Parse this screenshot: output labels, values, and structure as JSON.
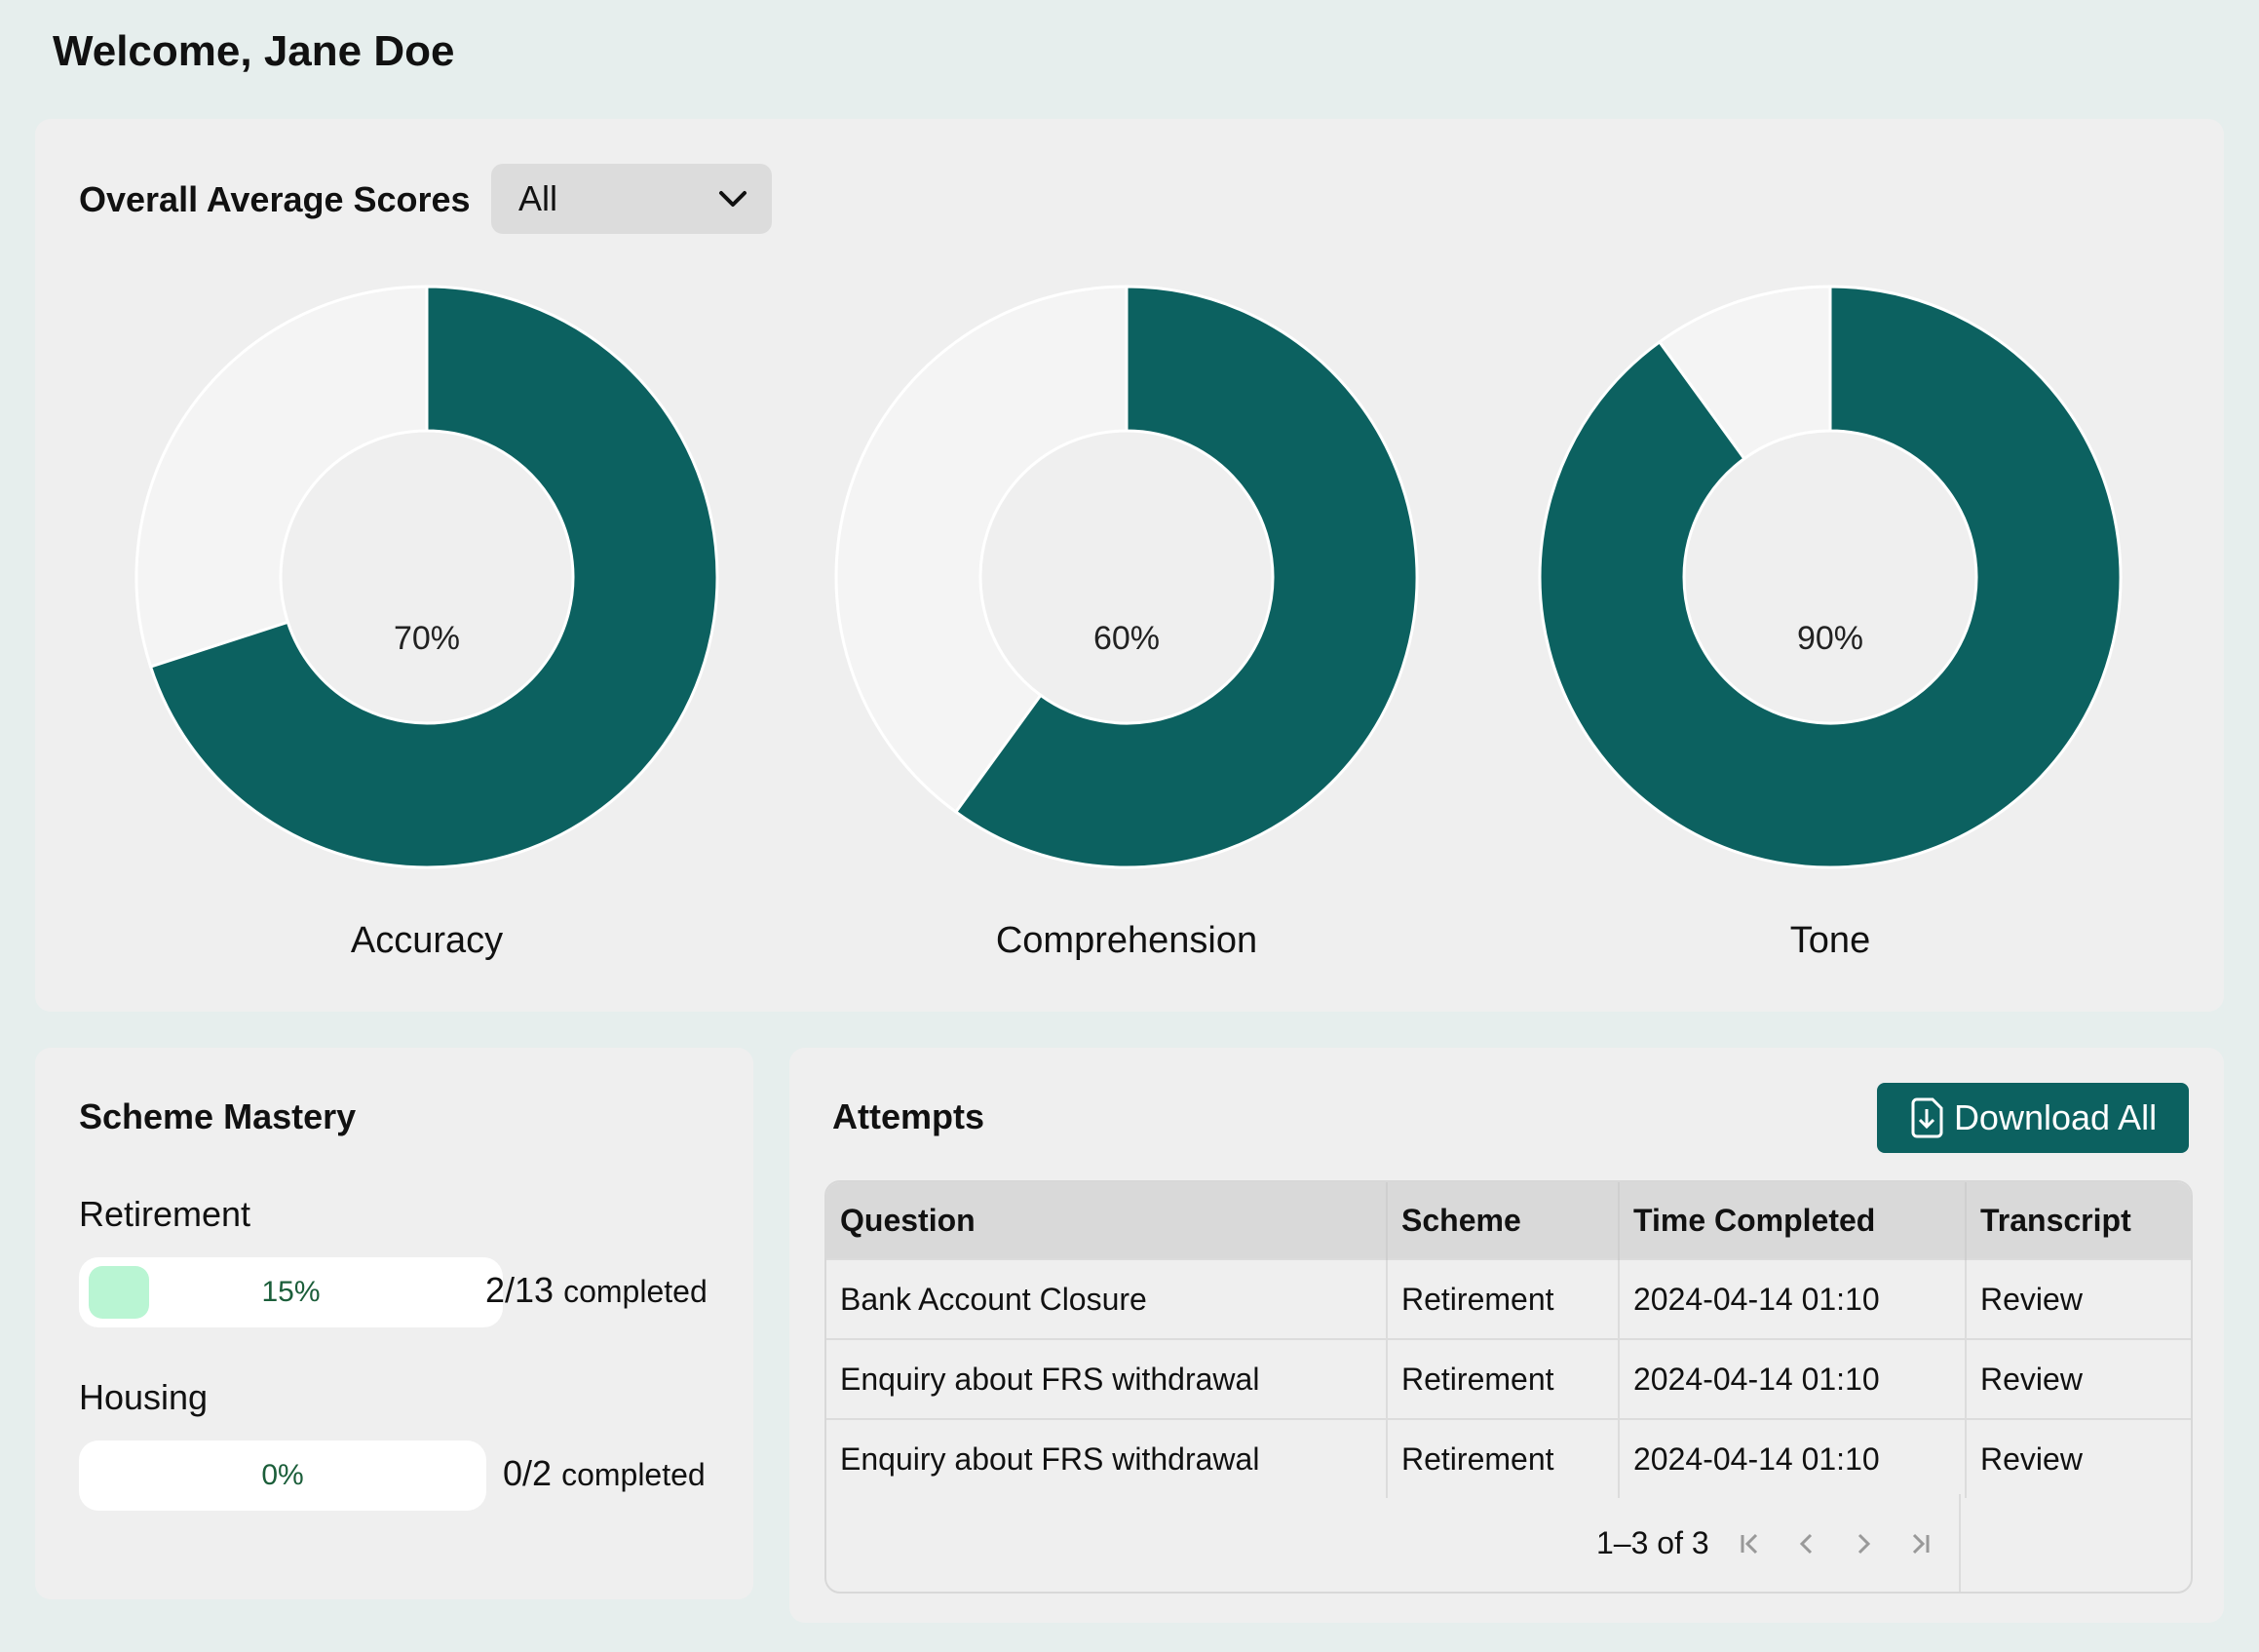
{
  "header": {
    "welcome": "Welcome, Jane Doe"
  },
  "scores": {
    "title": "Overall Average Scores",
    "filter": {
      "selected": "All",
      "icon": "chevron-down-icon"
    },
    "accent_color": "#0c6160",
    "track_color": "#f4f4f4"
  },
  "chart_data": [
    {
      "type": "pie",
      "label": "Accuracy",
      "value": 70,
      "value_label": "70%"
    },
    {
      "type": "pie",
      "label": "Comprehension",
      "value": 60,
      "value_label": "60%"
    },
    {
      "type": "pie",
      "label": "Tone",
      "value": 90,
      "value_label": "90%"
    }
  ],
  "mastery": {
    "title": "Scheme Mastery",
    "items": [
      {
        "name": "Retirement",
        "percent_label": "15%",
        "progress": 0.15,
        "count": "2/13",
        "suffix": "completed"
      },
      {
        "name": "Housing",
        "percent_label": "0%",
        "progress": 0,
        "count": "0/2",
        "suffix": "completed"
      }
    ],
    "fill_color": "#b9f5d3"
  },
  "attempts": {
    "title": "Attempts",
    "download_label": "Download All",
    "columns": [
      "Question",
      "Scheme",
      "Time Completed",
      "Transcript"
    ],
    "rows": [
      [
        "Bank Account Closure",
        "Retirement",
        "2024-04-14 01:10",
        "Review"
      ],
      [
        "Enquiry about FRS withdrawal",
        "Retirement",
        "2024-04-14 01:10",
        "Review"
      ],
      [
        "Enquiry about FRS withdrawal",
        "Retirement",
        "2024-04-14 01:10",
        "Review"
      ]
    ],
    "pagination": {
      "range": "1–3 of 3"
    }
  }
}
